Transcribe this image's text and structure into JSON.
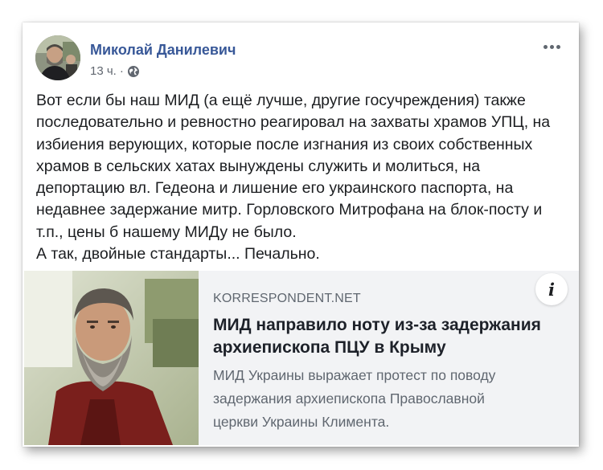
{
  "post": {
    "author": "Миколай Данилевич",
    "time": "13 ч.",
    "separator": "·",
    "privacy_icon": "globe-icon",
    "text_lines": [
      "Вот если бы наш МИД (а ещё лучше, другие госучреждения) также",
      "последовательно и ревностно реагировал на захваты храмов УПЦ, на",
      "избиения верующих, которые после изгнания из своих собственных",
      "храмов в сельских хатах вынуждены служить и молиться, на",
      "депортацию вл. Гедеона и лишение его украинского паспорта, на",
      "недавнее задержание митр. Горловского Митрофана на блок-посту и",
      "т.п., цены б нашему МИДу не было.",
      "А так, двойные стандарты... Печально."
    ]
  },
  "link": {
    "domain": "KORRESPONDENT.NET",
    "headline_lines": [
      "МИД направило ноту из-за задержания",
      "архиепископа ПЦУ в Крыму"
    ],
    "description_lines": [
      "МИД Украины выражает протест по поводу",
      "задержания архиепископа Православной",
      "церкви Украины Климента."
    ],
    "info_label": "i"
  },
  "colors": {
    "author": "#385898",
    "meta": "#616770",
    "text": "#1c1e21",
    "card_background": "#f2f3f5",
    "headline": "#1d2129",
    "description": "#606770"
  }
}
